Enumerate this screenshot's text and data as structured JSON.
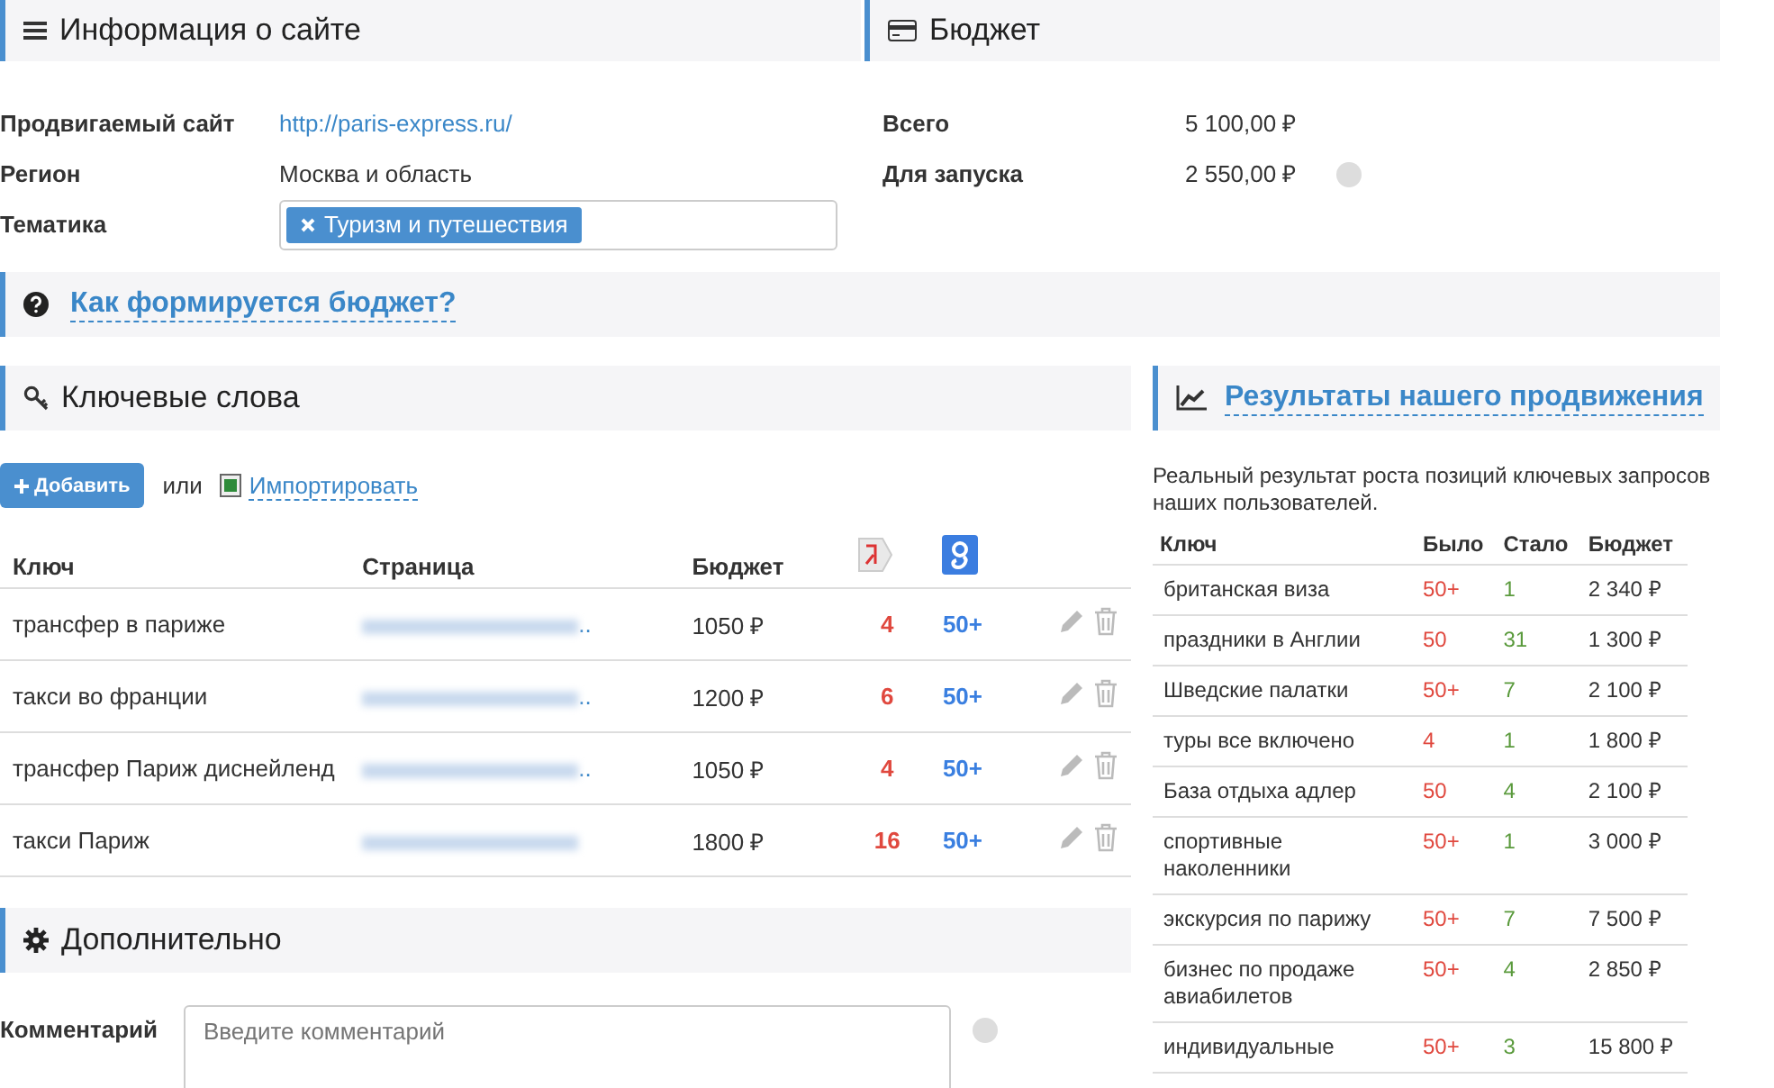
{
  "site_info": {
    "title": "Информация о сайте",
    "fields": [
      {
        "kind": "link",
        "label": "Продвигаемый сайт",
        "value": "http://paris-express.ru/"
      },
      {
        "kind": "text",
        "label": "Регион",
        "value": "Москва и область"
      },
      {
        "kind": "tags",
        "label": "Тематика",
        "tags": [
          "Туризм и путешествия"
        ]
      }
    ]
  },
  "budget": {
    "title": "Бюджет",
    "fields": [
      {
        "label": "Всего",
        "value": "5 100,00 ₽",
        "help": false
      },
      {
        "label": "Для запуска",
        "value": "2 550,00 ₽",
        "help": true
      }
    ]
  },
  "budget_help_link": "Как формируется бюджет?",
  "keywords": {
    "title": "Ключевые слова",
    "add_button": "Добавить",
    "or_text": "или",
    "import_link": "Импортировать",
    "columns": [
      "Ключ",
      "Страница",
      "Бюджет"
    ],
    "rows": [
      {
        "key": "трансфер в париже",
        "page_tail": "..",
        "budget": "1050 ₽",
        "yandex": "4",
        "google": "50+"
      },
      {
        "key": "такси во франции",
        "page_tail": "..",
        "budget": "1200 ₽",
        "yandex": "6",
        "google": "50+"
      },
      {
        "key": "трансфер Париж диснейленд",
        "page_tail": "..",
        "budget": "1050 ₽",
        "yandex": "4",
        "google": "50+"
      },
      {
        "key": "такси Париж",
        "budget": "1800 ₽",
        "yandex": "16",
        "google": "50+"
      }
    ]
  },
  "extra": {
    "title": "Дополнительно",
    "comment_label": "Комментарий",
    "comment_placeholder": "Введите комментарий"
  },
  "results": {
    "title": "Результаты нашего продвижения",
    "description": "Реальный результат роста позиций ключевых запросов наших пользователей.",
    "columns": [
      "Ключ",
      "Было",
      "Стало",
      "Бюджет"
    ],
    "rows": [
      {
        "key": "британская виза",
        "was": "50+",
        "now": "1",
        "budget": "2 340 ₽"
      },
      {
        "key": "праздники в Англии",
        "was": "50",
        "now": "31",
        "budget": "1 300 ₽"
      },
      {
        "key": "Шведские палатки",
        "was": "50+",
        "now": "7",
        "budget": "2 100 ₽"
      },
      {
        "key": "туры все включено",
        "was": "4",
        "now": "1",
        "budget": "1 800 ₽"
      },
      {
        "key": "База отдыха адлер",
        "was": "50",
        "now": "4",
        "budget": "2 100 ₽"
      },
      {
        "key": "спортивные наколенники",
        "was": "50+",
        "now": "1",
        "budget": "3 000 ₽"
      },
      {
        "key": "экскурсия по парижу",
        "was": "50+",
        "now": "7",
        "budget": "7 500 ₽"
      },
      {
        "key": "бизнес по продаже авиабилетов",
        "was": "50+",
        "now": "4",
        "budget": "2 850 ₽"
      },
      {
        "key": "индивидуальные",
        "was": "50+",
        "now": "3",
        "budget": "15 800 ₽"
      }
    ]
  }
}
